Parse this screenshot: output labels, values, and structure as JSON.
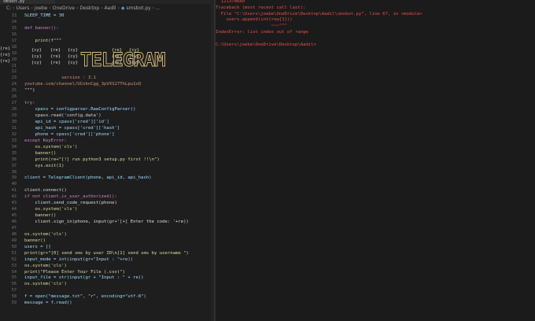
{
  "editor": {
    "tab_label": "smsbot.py",
    "breadcrumbs": [
      "C:",
      "Users",
      "joebe",
      "OneDrive",
      "Desktop",
      "Aadil",
      "smsbot.py",
      "..."
    ],
    "lines": [
      {
        "n": "13",
        "code": "SLEEP_TIME = 30"
      },
      {
        "n": "14",
        "code": ""
      },
      {
        "n": "15",
        "code": "def banner():"
      },
      {
        "n": "16",
        "code": ""
      },
      {
        "n": "17",
        "code": "    print(f\"\"\""
      },
      {
        "n": "18",
        "code": ""
      },
      {
        "n": "19",
        "code": ""
      },
      {
        "n": "20",
        "code": ""
      },
      {
        "n": "21",
        "code": ""
      },
      {
        "n": "22",
        "code": ""
      },
      {
        "n": "23",
        "code": "              version : 3.1"
      },
      {
        "n": "24",
        "code": "youtube.com/channel/UCnknCgg_3pVXS27ThLpu1xQ"
      },
      {
        "n": "25",
        "code": "\"\"\")"
      },
      {
        "n": "26",
        "code": ""
      },
      {
        "n": "27",
        "code": "try:"
      },
      {
        "n": "28",
        "code": "    cpass = configparser.RawConfigParser()"
      },
      {
        "n": "29",
        "code": "    cpass.read('config.data')"
      },
      {
        "n": "30",
        "code": "    api_id = cpass['cred']['id']"
      },
      {
        "n": "31",
        "code": "    api_hash = cpass['cred']['hash']"
      },
      {
        "n": "32",
        "code": "    phone = cpass['cred']['phone']"
      },
      {
        "n": "33",
        "code": "except KeyError:"
      },
      {
        "n": "34",
        "code": "    os.system('cls')"
      },
      {
        "n": "35",
        "code": "    banner()"
      },
      {
        "n": "36",
        "code": "    print(re+\"[!] run python3 setup.py first !!\\n\")"
      },
      {
        "n": "37",
        "code": "    sys.exit(1)"
      },
      {
        "n": "38",
        "code": ""
      },
      {
        "n": "39",
        "code": "client = TelegramClient(phone, api_id, api_hash)"
      },
      {
        "n": "40",
        "code": ""
      },
      {
        "n": "41",
        "code": "client.connect()"
      },
      {
        "n": "42",
        "code": "if not client.is_user_authorized():"
      },
      {
        "n": "43",
        "code": "    client.send_code_request(phone)"
      },
      {
        "n": "44",
        "code": "    os.system('cls')"
      },
      {
        "n": "45",
        "code": "    banner()"
      },
      {
        "n": "46",
        "code": "    client.sign_in(phone, input(gr+'[+] Enter the code: '+re))"
      },
      {
        "n": "47",
        "code": ""
      },
      {
        "n": "48",
        "code": "os.system('cls')"
      },
      {
        "n": "49",
        "code": "banner()"
      },
      {
        "n": "50",
        "code": "users = []"
      },
      {
        "n": "51",
        "code": "print(gr+\"[0] send sms by user ID\\n[1] send sms by username \")"
      },
      {
        "n": "52",
        "code": "input_mode = int(input(gr+\"Input : \"+re))"
      },
      {
        "n": "53",
        "code": "os.system('cls')"
      },
      {
        "n": "54",
        "code": "print(\"Please Enter Your File (.csv)\")"
      },
      {
        "n": "55",
        "code": "input_file = str(input(gr + \"Input : \" + re))"
      },
      {
        "n": "56",
        "code": "os.system('cls')"
      },
      {
        "n": "57",
        "code": ""
      },
      {
        "n": "58",
        "code": "f = open(\"message.txt\", \"r\", encoding=\"utf-8\")"
      },
      {
        "n": "59",
        "code": "message = f.read()"
      }
    ],
    "banner_prefix": [
      "{re}",
      "{re}",
      "{re}"
    ],
    "banner_cells": [
      "{cy}",
      "{re}",
      "{cy}",
      "{re}",
      "{cy}"
    ],
    "banner_text": "TELEGRAM"
  },
  "terminal": {
    "lines": [
      "  12137d680",
      "Traceback (most recent call last):",
      "  File \"C:\\Users\\joebe\\OneDrive\\Desktop\\Aadil\\smsbot.py\", line 67, in <module>",
      "    users.append(int(row[1]))",
      "                     ~~~^^^",
      "IndexError: list index out of range",
      "",
      "C:\\Users\\joebe\\OneDrive\\Desktop\\Aadil>"
    ]
  },
  "colors": {
    "editor_bg": "#1e1e1e",
    "terminal_bg": "#1b1b1b",
    "error_red": "#f14c4c",
    "banner_gold": "#d7ba7d"
  }
}
